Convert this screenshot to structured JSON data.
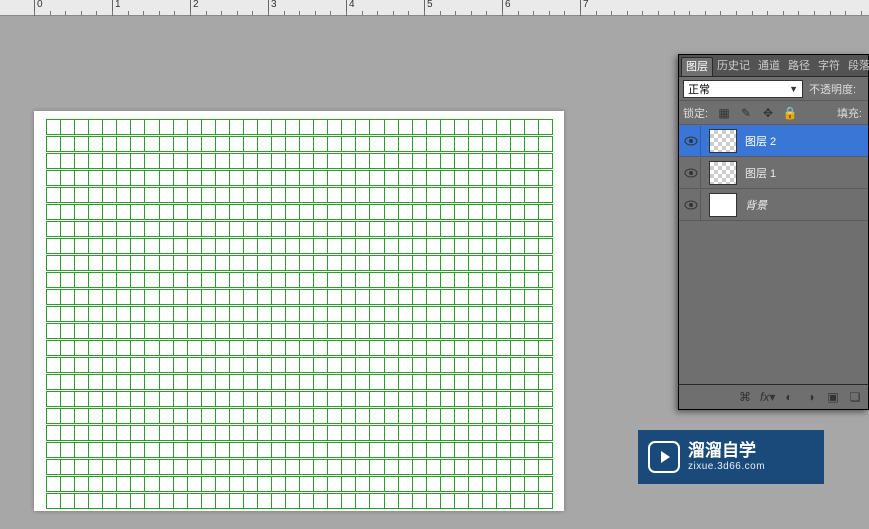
{
  "ruler": {
    "marks": [
      "0",
      "1",
      "2",
      "3",
      "4",
      "5",
      "6",
      "7"
    ]
  },
  "panel": {
    "tabs": [
      "图层",
      "历史记",
      "通道",
      "路径",
      "字符",
      "段落"
    ],
    "blend_mode": "正常",
    "opacity_label": "不透明度:",
    "lock_label": "锁定:",
    "fill_label": "填充:"
  },
  "layers": [
    {
      "name": "图层 2",
      "selected": true,
      "checker": true,
      "bg": false
    },
    {
      "name": "图层 1",
      "selected": false,
      "checker": true,
      "bg": false
    },
    {
      "name": "背景",
      "selected": false,
      "checker": false,
      "bg": true
    }
  ],
  "lock_icons": [
    "pixels-icon",
    "brush-icon",
    "move-icon",
    "lock-icon"
  ],
  "footer_icons": [
    "link-icon",
    "fx-icon",
    "mask-icon",
    "adjustment-icon",
    "group-icon",
    "new-icon"
  ],
  "watermark": {
    "title": "溜溜自学",
    "sub": "zixue.3d66.com"
  }
}
